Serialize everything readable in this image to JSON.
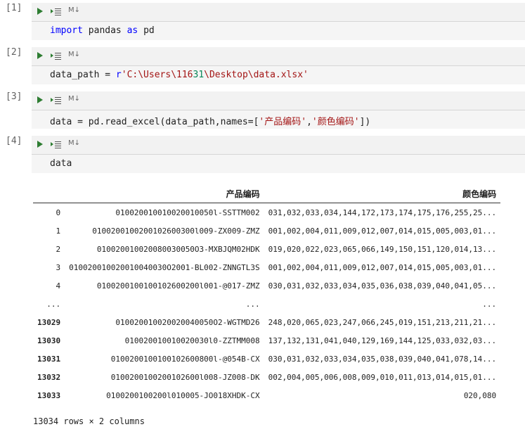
{
  "cells": [
    {
      "prompt": "[1]",
      "code": {
        "kw1": "import",
        "mid": " pandas ",
        "kw2": "as",
        "end": " pd"
      }
    },
    {
      "prompt": "[2]",
      "code": {
        "pre": "data_path = ",
        "prefix": "r",
        "str1": "'C:\\Users\\116",
        "num": "31",
        "str2": "\\Desktop\\data.xlsx'"
      }
    },
    {
      "prompt": "[3]",
      "code": {
        "pre": "data = pd.read_excel(data_path,names=[",
        "s1": "'产品编码'",
        "comma": ",",
        "s2": "'颜色编码'",
        "post": "])"
      }
    },
    {
      "prompt": "[4]",
      "code": {
        "text": "data"
      }
    }
  ],
  "toolbar": {
    "md_label": "M↓"
  },
  "output": {
    "columns": [
      "产品编码",
      "颜色编码"
    ],
    "rows": [
      {
        "idx": "0",
        "c1": "010020010010020010050l-SSTTM002",
        "c2": "031,032,033,034,144,172,173,174,175,176,255,25...",
        "bold": false
      },
      {
        "idx": "1",
        "c1": "0100200100200102600300l009-ZX009-ZMZ",
        "c2": "001,002,004,011,009,012,007,014,015,005,003,01...",
        "bold": false
      },
      {
        "idx": "2",
        "c1": "010020010020080030050O3-MXBJQM02HDK",
        "c2": "019,020,022,023,065,066,149,150,151,120,014,13...",
        "bold": false
      },
      {
        "idx": "3",
        "c1": "010020010020010040030O2001-BL002-ZNNGTL3S",
        "c2": "001,002,004,011,009,012,007,014,015,005,003,01...",
        "bold": false
      },
      {
        "idx": "4",
        "c1": "0100200100100102600200l001-@017-ZMZ",
        "c2": "030,031,032,033,034,035,036,038,039,040,041,05...",
        "bold": false
      },
      {
        "idx": "...",
        "c1": "...",
        "c2": "...",
        "bold": false
      },
      {
        "idx": "13029",
        "c1": "010020010020020040050O2-WGTMD26",
        "c2": "248,020,065,023,247,066,245,019,151,213,211,21...",
        "bold": true
      },
      {
        "idx": "13030",
        "c1": "010020010010020030l0-ZZTMM008",
        "c2": "137,132,131,041,040,129,169,144,125,033,032,03...",
        "bold": true
      },
      {
        "idx": "13031",
        "c1": "0100200100100102600800l-@054B-CX",
        "c2": "030,031,032,033,034,035,038,039,040,041,078,14...",
        "bold": true
      },
      {
        "idx": "13032",
        "c1": "0100200100200102600l008-JZ008-DK",
        "c2": "002,004,005,006,008,009,010,011,013,014,015,01...",
        "bold": true
      },
      {
        "idx": "13033",
        "c1": "0100200100200l010005-JO018XHDK-CX",
        "c2": "020,080",
        "bold": true
      }
    ],
    "summary": "13034 rows × 2 columns"
  }
}
